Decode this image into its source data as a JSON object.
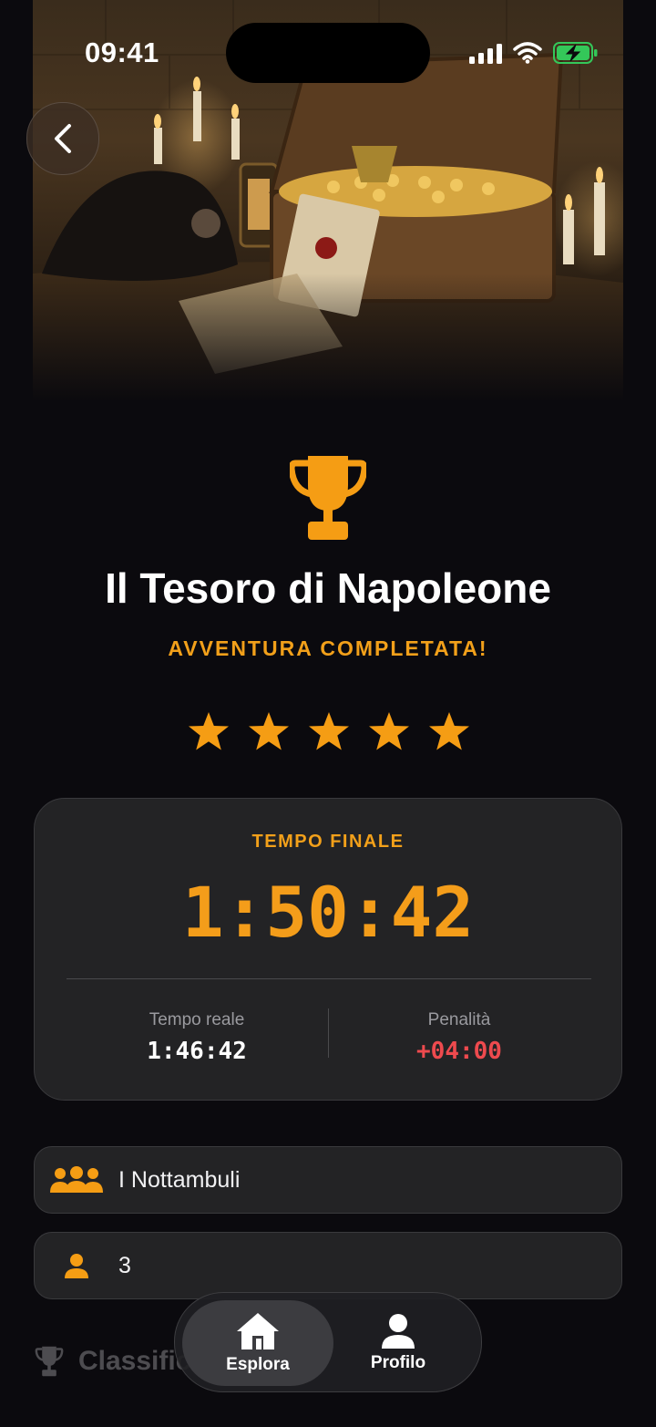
{
  "status_bar": {
    "time": "09:41"
  },
  "hero": {
    "image": "treasure-chest-napoleon-hat-scene"
  },
  "header": {
    "title": "Il Tesoro di Napoleone",
    "subtitle": "AVVENTURA COMPLETATA!",
    "rating": {
      "value": 5,
      "max": 5
    }
  },
  "time_card": {
    "label": "TEMPO FINALE",
    "final_time": "1:50:42",
    "real_time_label": "Tempo reale",
    "real_time": "1:46:42",
    "penalty_label": "Penalità",
    "penalty": "+04:00"
  },
  "team": {
    "name": "I Nottambuli",
    "players": "3"
  },
  "leaderboard": {
    "label": "Classific"
  },
  "tabbar": {
    "items": [
      {
        "label": "Esplora",
        "icon": "house-icon",
        "active": true
      },
      {
        "label": "Profilo",
        "icon": "person-icon",
        "active": false
      }
    ]
  },
  "colors": {
    "accent": "#f2a01a",
    "penalty": "#ee4a4e",
    "background": "#0b0a0e",
    "card": "#232325"
  }
}
